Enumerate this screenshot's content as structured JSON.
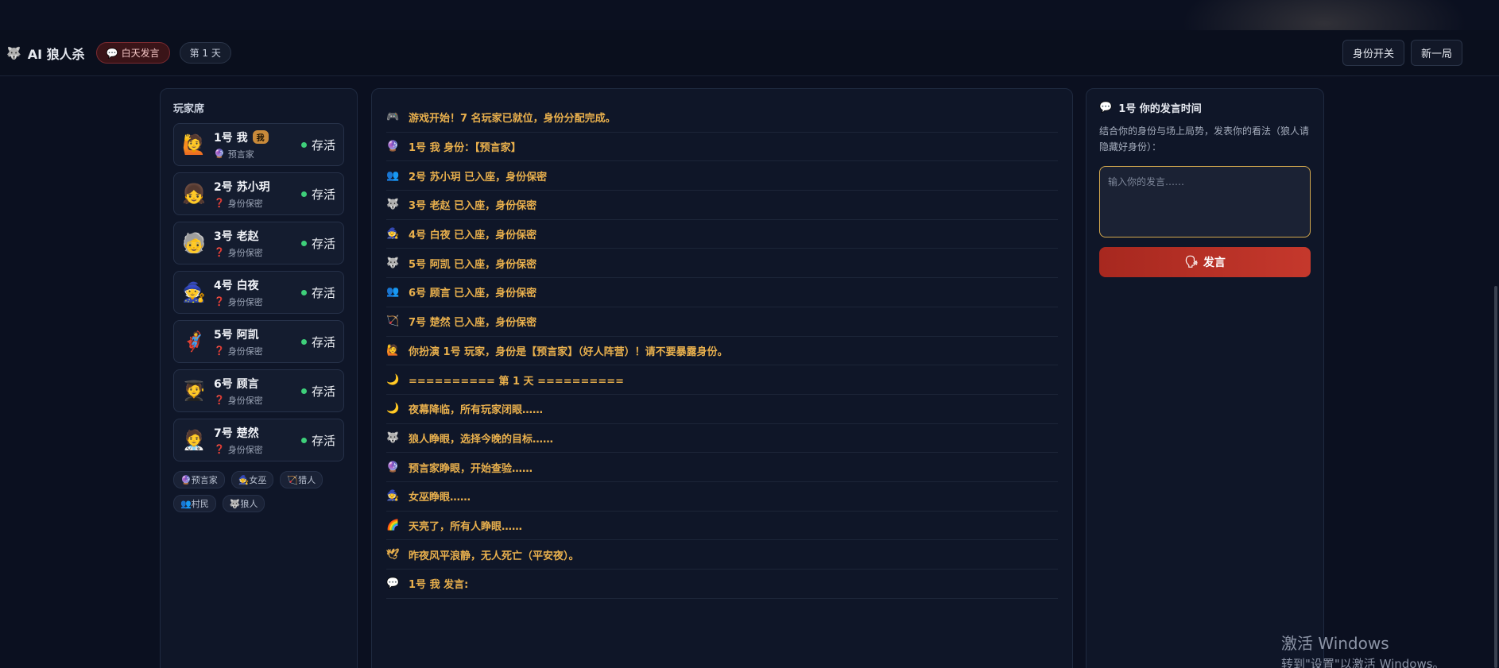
{
  "header": {
    "logo_icon": "🐺",
    "title": "AI 狼人杀",
    "phase_icon": "💬",
    "phase_label": "白天发言",
    "day_label": "第 1 天",
    "btn_identity": "身份开关",
    "btn_new_game": "新一局"
  },
  "players_panel": {
    "title": "玩家席",
    "players": [
      {
        "name": "1号 我",
        "me_tag": "我",
        "avatar": "🙋",
        "role_icon": "🔮",
        "role": "预言家",
        "status": "存活"
      },
      {
        "name": "2号 苏小玥",
        "avatar": "👧",
        "role_icon": "❓",
        "role": "身份保密",
        "status": "存活"
      },
      {
        "name": "3号 老赵",
        "avatar": "🧓",
        "role_icon": "❓",
        "role": "身份保密",
        "status": "存活"
      },
      {
        "name": "4号 白夜",
        "avatar": "🧙",
        "role_icon": "❓",
        "role": "身份保密",
        "status": "存活"
      },
      {
        "name": "5号 阿凯",
        "avatar": "🦸",
        "role_icon": "❓",
        "role": "身份保密",
        "status": "存活"
      },
      {
        "name": "6号 顾言",
        "avatar": "🧑‍🎓",
        "role_icon": "❓",
        "role": "身份保密",
        "status": "存活"
      },
      {
        "name": "7号 楚然",
        "avatar": "🧑‍⚕️",
        "role_icon": "❓",
        "role": "身份保密",
        "status": "存活"
      }
    ],
    "legend": [
      "🔮预言家",
      "🧙女巫",
      "🏹猎人",
      "👥村民",
      "🐺狼人"
    ]
  },
  "log": [
    {
      "icon": "🎮",
      "text": "游戏开始！7 名玩家已就位，身份分配完成。"
    },
    {
      "icon": "🔮",
      "text": "1号 我 身份：【预言家】"
    },
    {
      "icon": "👥",
      "text": "2号 苏小玥 已入座，身份保密"
    },
    {
      "icon": "🐺",
      "text": "3号 老赵 已入座，身份保密"
    },
    {
      "icon": "🧙",
      "text": "4号 白夜 已入座，身份保密"
    },
    {
      "icon": "🐺",
      "text": "5号 阿凯 已入座，身份保密"
    },
    {
      "icon": "👥",
      "text": "6号 顾言 已入座，身份保密"
    },
    {
      "icon": "🏹",
      "text": "7号 楚然 已入座，身份保密"
    },
    {
      "icon": "🙋",
      "text": "你扮演 1号 玩家，身份是【预言家】（好人阵营）！请不要暴露身份。"
    },
    {
      "icon": "🌙",
      "text": "========== 第 1 天 =========="
    },
    {
      "icon": "🌙",
      "text": "夜幕降临，所有玩家闭眼……"
    },
    {
      "icon": "🐺",
      "text": "狼人睁眼，选择今晚的目标……"
    },
    {
      "icon": "🔮",
      "text": "预言家睁眼，开始查验……"
    },
    {
      "icon": "🧙",
      "text": "女巫睁眼……"
    },
    {
      "icon": "🌈",
      "text": "天亮了，所有人睁眼……"
    },
    {
      "icon": "🕊",
      "text": "昨夜风平浪静，无人死亡（平安夜）。"
    },
    {
      "icon": "💬",
      "text": "1号 我 发言:"
    }
  ],
  "speak_panel": {
    "icon": "💬",
    "title": "1号 你的发言时间",
    "description": "结合你的身份与场上局势，发表你的看法（狼人请隐藏好身份）：",
    "placeholder": "输入你的发言……",
    "button_icon": "🗣",
    "button_label": "发言"
  },
  "watermark": {
    "line1": "激活 Windows",
    "line2": "转到\"设置\"以激活 Windows。"
  },
  "colors": {
    "background": "#0b1020",
    "panel": "#0f1628",
    "log_text": "#e9b04d",
    "speak_button": "#c5382c",
    "alive_dot": "#3ecf7a"
  }
}
